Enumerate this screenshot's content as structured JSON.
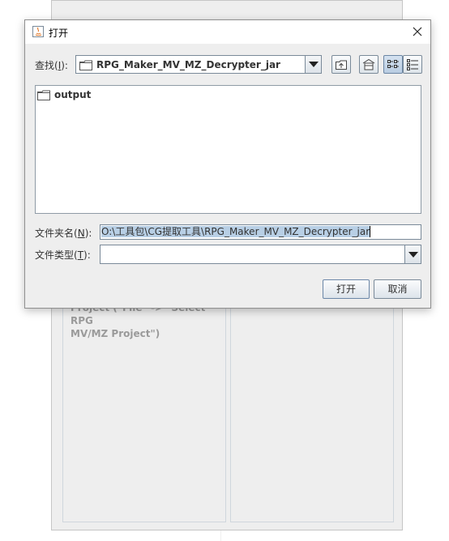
{
  "background_window": {
    "hint_text": "Project (\"File\" -> \"Select RPG\nMV/MZ Project\")"
  },
  "dialog": {
    "title": "打开",
    "close_icon": "close-icon",
    "look_in": {
      "label": "查找",
      "mnemonic": "I",
      "value": "RPG_Maker_MV_MZ_Decrypter_jar"
    },
    "toolbar": {
      "up_one_level": "up-folder-icon",
      "home": "home-icon",
      "list_view": "list-view-icon",
      "details_view": "details-view-icon",
      "active_view": "list"
    },
    "files": [
      {
        "name": "output",
        "icon": "folder-icon"
      }
    ],
    "file_name": {
      "label": "文件夹名",
      "mnemonic": "N",
      "value": "O:\\工具包\\CG提取工具\\RPG_Maker_MV_MZ_Decrypter_jar"
    },
    "file_type": {
      "label": "文件类型",
      "mnemonic": "T",
      "value": ""
    },
    "buttons": {
      "open": "打开",
      "cancel": "取消"
    }
  }
}
